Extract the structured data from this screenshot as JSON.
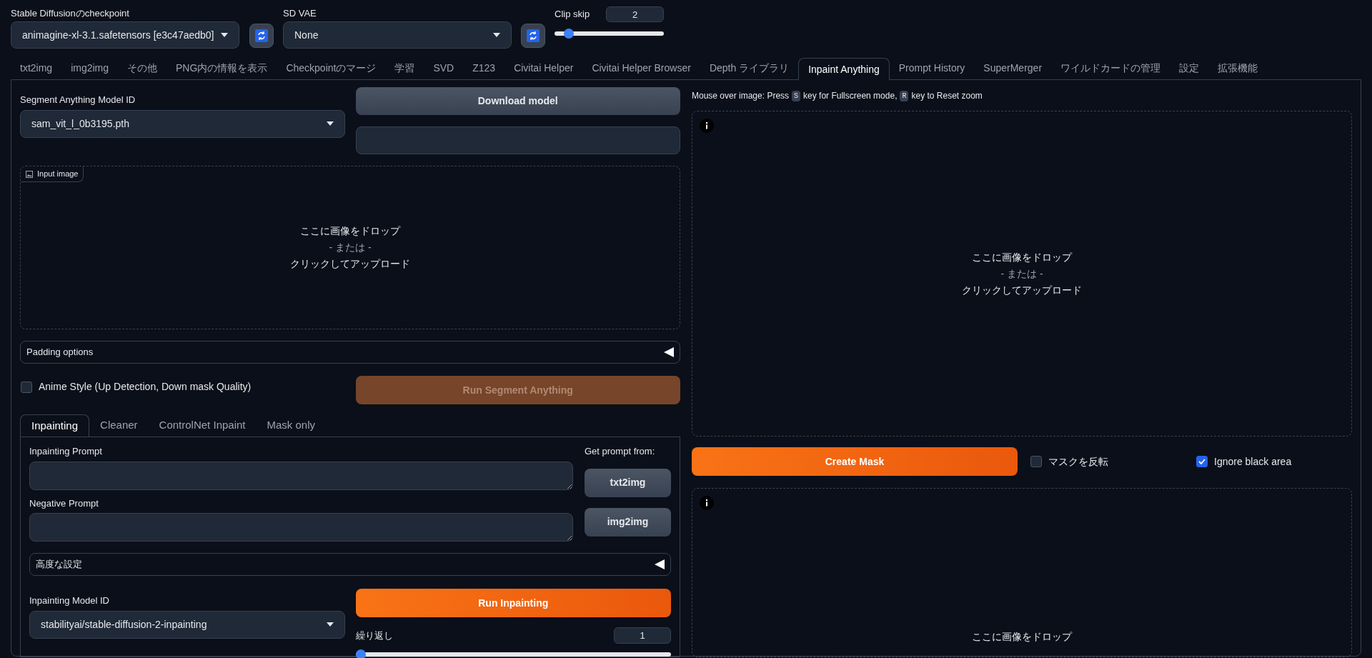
{
  "top_bar": {
    "checkpoint": {
      "label": "Stable Diffusionのcheckpoint",
      "value": "animagine-xl-3.1.safetensors [e3c47aedb0]"
    },
    "vae": {
      "label": "SD VAE",
      "value": "None"
    },
    "clip_skip": {
      "label": "Clip skip",
      "value": "2",
      "level": 0.09
    }
  },
  "tabs": [
    {
      "label": "txt2img",
      "selected": false
    },
    {
      "label": "img2img",
      "selected": false
    },
    {
      "label": "その他",
      "selected": false
    },
    {
      "label": "PNG内の情報を表示",
      "selected": false
    },
    {
      "label": "Checkpointのマージ",
      "selected": false
    },
    {
      "label": "学習",
      "selected": false
    },
    {
      "label": "SVD",
      "selected": false
    },
    {
      "label": "Z123",
      "selected": false
    },
    {
      "label": "Civitai Helper",
      "selected": false
    },
    {
      "label": "Civitai Helper Browser",
      "selected": false
    },
    {
      "label": "Depth ライブラリ",
      "selected": false
    },
    {
      "label": "Inpaint Anything",
      "selected": true
    },
    {
      "label": "Prompt History",
      "selected": false
    },
    {
      "label": "SuperMerger",
      "selected": false
    },
    {
      "label": "ワイルドカードの管理",
      "selected": false
    },
    {
      "label": "設定",
      "selected": false
    },
    {
      "label": "拡張機能",
      "selected": false
    }
  ],
  "left": {
    "sam_model": {
      "label": "Segment Anything Model ID",
      "value": "sam_vit_l_0b3195.pth"
    },
    "download_button": "Download model",
    "input_image": {
      "label": "Input image",
      "drop": "ここに画像をドロップ",
      "or": "- または -",
      "click": "クリックしてアップロード"
    },
    "padding_options": {
      "label": "Padding options",
      "expanded": false
    },
    "anime_style": {
      "label": "Anime Style (Up Detection, Down mask Quality)",
      "checked": false
    },
    "run_segment_button": {
      "label": "Run Segment Anything",
      "disabled": true
    },
    "sub_tabs": [
      {
        "label": "Inpainting",
        "selected": true
      },
      {
        "label": "Cleaner",
        "selected": false
      },
      {
        "label": "ControlNet Inpaint",
        "selected": false
      },
      {
        "label": "Mask only",
        "selected": false
      }
    ],
    "inpainting": {
      "prompt_label": "Inpainting Prompt",
      "negative_label": "Negative Prompt",
      "get_prompt_label": "Get prompt from:",
      "prompt_buttons": [
        "txt2img",
        "img2img"
      ],
      "advanced": {
        "label": "高度な設定",
        "expanded": false
      },
      "model": {
        "label": "Inpainting Model ID",
        "value": "stabilityai/stable-diffusion-2-inpainting"
      },
      "run_button": "Run Inpainting",
      "iterations": {
        "label": "繰り返し",
        "value": "1",
        "level": 0
      }
    }
  },
  "right": {
    "hint": [
      {
        "kind": "text",
        "text": "Mouse over image: Press"
      },
      {
        "kind": "key",
        "text": "S"
      },
      {
        "kind": "text",
        "text": "key for Fullscreen mode,"
      },
      {
        "kind": "key",
        "text": "R"
      },
      {
        "kind": "text",
        "text": "key to Reset zoom"
      }
    ],
    "sam_image": {
      "drop": "ここに画像をドロップ",
      "or": "- または -",
      "click": "クリックしてアップロード"
    },
    "create_mask_button": "Create Mask",
    "invert_mask": {
      "label": "マスクを反転",
      "checked": false
    },
    "ignore_black": {
      "label": "Ignore black area",
      "checked": true
    },
    "mask_image": {
      "drop": "ここに画像をドロップ"
    }
  }
}
